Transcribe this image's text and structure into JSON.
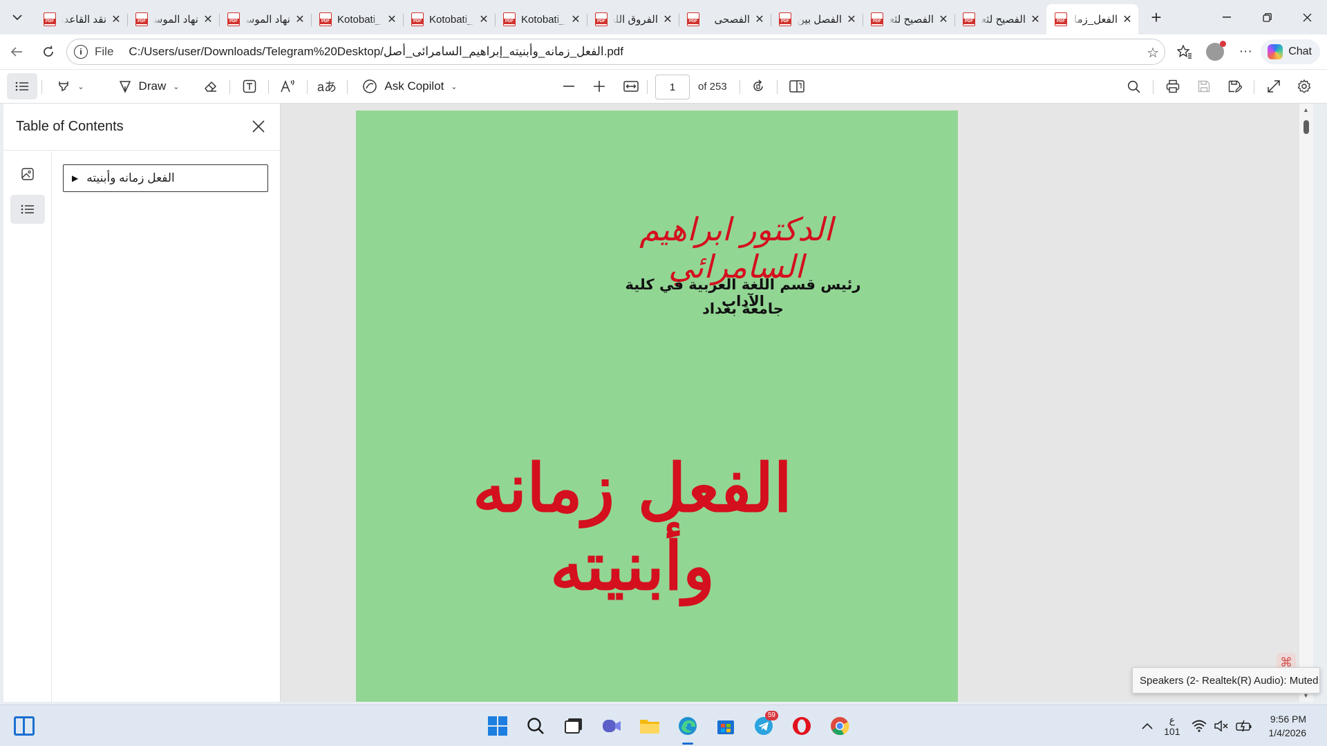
{
  "tabs": [
    {
      "title": "نقد القاعدة",
      "ltr": false,
      "active": false
    },
    {
      "title": "نهاد الموسى",
      "ltr": false,
      "active": false
    },
    {
      "title": "نهاد الموسى",
      "ltr": false,
      "active": false
    },
    {
      "title": "Kotobati_",
      "ltr": true,
      "active": false
    },
    {
      "title": "Kotobati_",
      "ltr": true,
      "active": false
    },
    {
      "title": "Kotobati_",
      "ltr": true,
      "active": false
    },
    {
      "title": "الفروق اللغوية",
      "ltr": false,
      "active": false
    },
    {
      "title": "الفصحى",
      "ltr": false,
      "active": false
    },
    {
      "title": "الفصل بين",
      "ltr": false,
      "active": false
    },
    {
      "title": "الفصيح لثعلب",
      "ltr": false,
      "active": false
    },
    {
      "title": "الفصيح لثعلب",
      "ltr": false,
      "active": false
    },
    {
      "title": "الفعل_زمانه",
      "ltr": false,
      "active": true
    }
  ],
  "address": {
    "scheme_label": "File",
    "url": "C:/Users/user/Downloads/Telegram%20Desktop/الفعل_زمانه_وأبنيته_إبراهيم_السامرائى_أصل.pdf"
  },
  "copilot": {
    "label": "Chat"
  },
  "pdf_toolbar": {
    "draw_label": "Draw",
    "ask_copilot_label": "Ask Copilot",
    "page_current": "1",
    "page_total_label": "of 253"
  },
  "side_panel": {
    "title": "Table of Contents",
    "toc": [
      {
        "label": "الفعل زمانه وأبنيته",
        "collapsed": true
      }
    ]
  },
  "page_content": {
    "author": "الدكتور ابراهيم السامرائي",
    "affiliation_line1": "رئيس قسم اللغة العربية في كلية الآداب",
    "affiliation_line2": "جامعة بغداد",
    "book_title": "الفعل زمانه وأبنيته",
    "page_color": "#92d694",
    "title_color": "#d40f1e"
  },
  "notification": {
    "text": "Speakers (2- Realtek(R) Audio): Muted"
  },
  "taskbar": {
    "telegram_badge": "59",
    "lang_top": "ع",
    "lang_bottom": "101",
    "time": "9:56 PM",
    "date": "1/4/2026"
  }
}
